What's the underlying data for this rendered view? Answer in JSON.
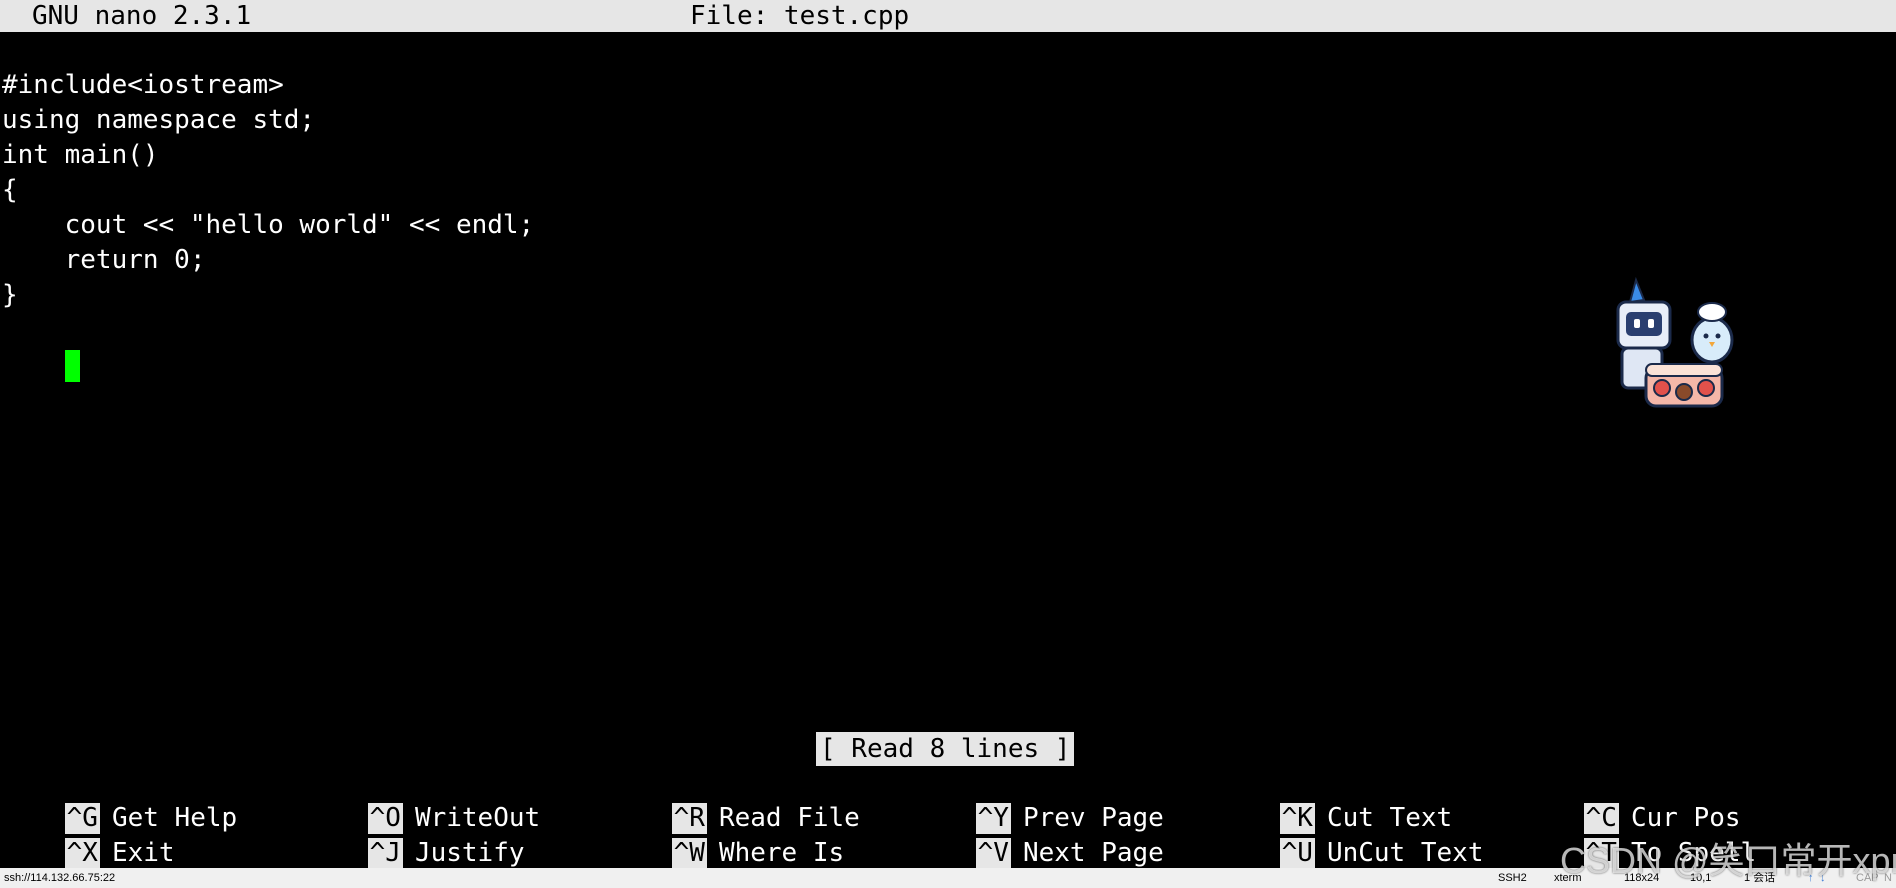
{
  "titlebar": {
    "app_version": "GNU nano 2.3.1",
    "file_label": "File: test.cpp"
  },
  "editor": {
    "lines": [
      "",
      "#include<iostream>",
      "using namespace std;",
      "int main()",
      "{",
      "    cout << \"hello world\" << endl;",
      "    return 0;",
      "}"
    ]
  },
  "status": {
    "message": "[ Read 8 lines ]"
  },
  "shortcuts": {
    "row1": [
      {
        "key": "^G",
        "label": "Get Help"
      },
      {
        "key": "^O",
        "label": "WriteOut"
      },
      {
        "key": "^R",
        "label": "Read File"
      },
      {
        "key": "^Y",
        "label": "Prev Page"
      },
      {
        "key": "^K",
        "label": "Cut Text"
      },
      {
        "key": "^C",
        "label": "Cur Pos"
      }
    ],
    "row2": [
      {
        "key": "^X",
        "label": "Exit"
      },
      {
        "key": "^J",
        "label": "Justify"
      },
      {
        "key": "^W",
        "label": "Where Is"
      },
      {
        "key": "^V",
        "label": "Next Page"
      },
      {
        "key": "^U",
        "label": "UnCut Text"
      },
      {
        "key": "^T",
        "label": "To Spell"
      }
    ]
  },
  "clientbar": {
    "connection": "ssh://114.132.66.75:22",
    "protocol": "SSH2",
    "terminal": "xterm",
    "size": "118x24",
    "cursor_pos": "10,1",
    "sessions": "1 会话",
    "caps": "CAP",
    "num": "N"
  },
  "watermark": "CSDN @笑口常开xpr",
  "colors": {
    "background": "#000000",
    "bar": "#e6e6e6",
    "cursor": "#00ff00"
  },
  "icons": [
    "mascot-sticker-icon",
    "lock-icon",
    "resize-icon",
    "arrow-up-icon",
    "arrow-down-icon"
  ]
}
